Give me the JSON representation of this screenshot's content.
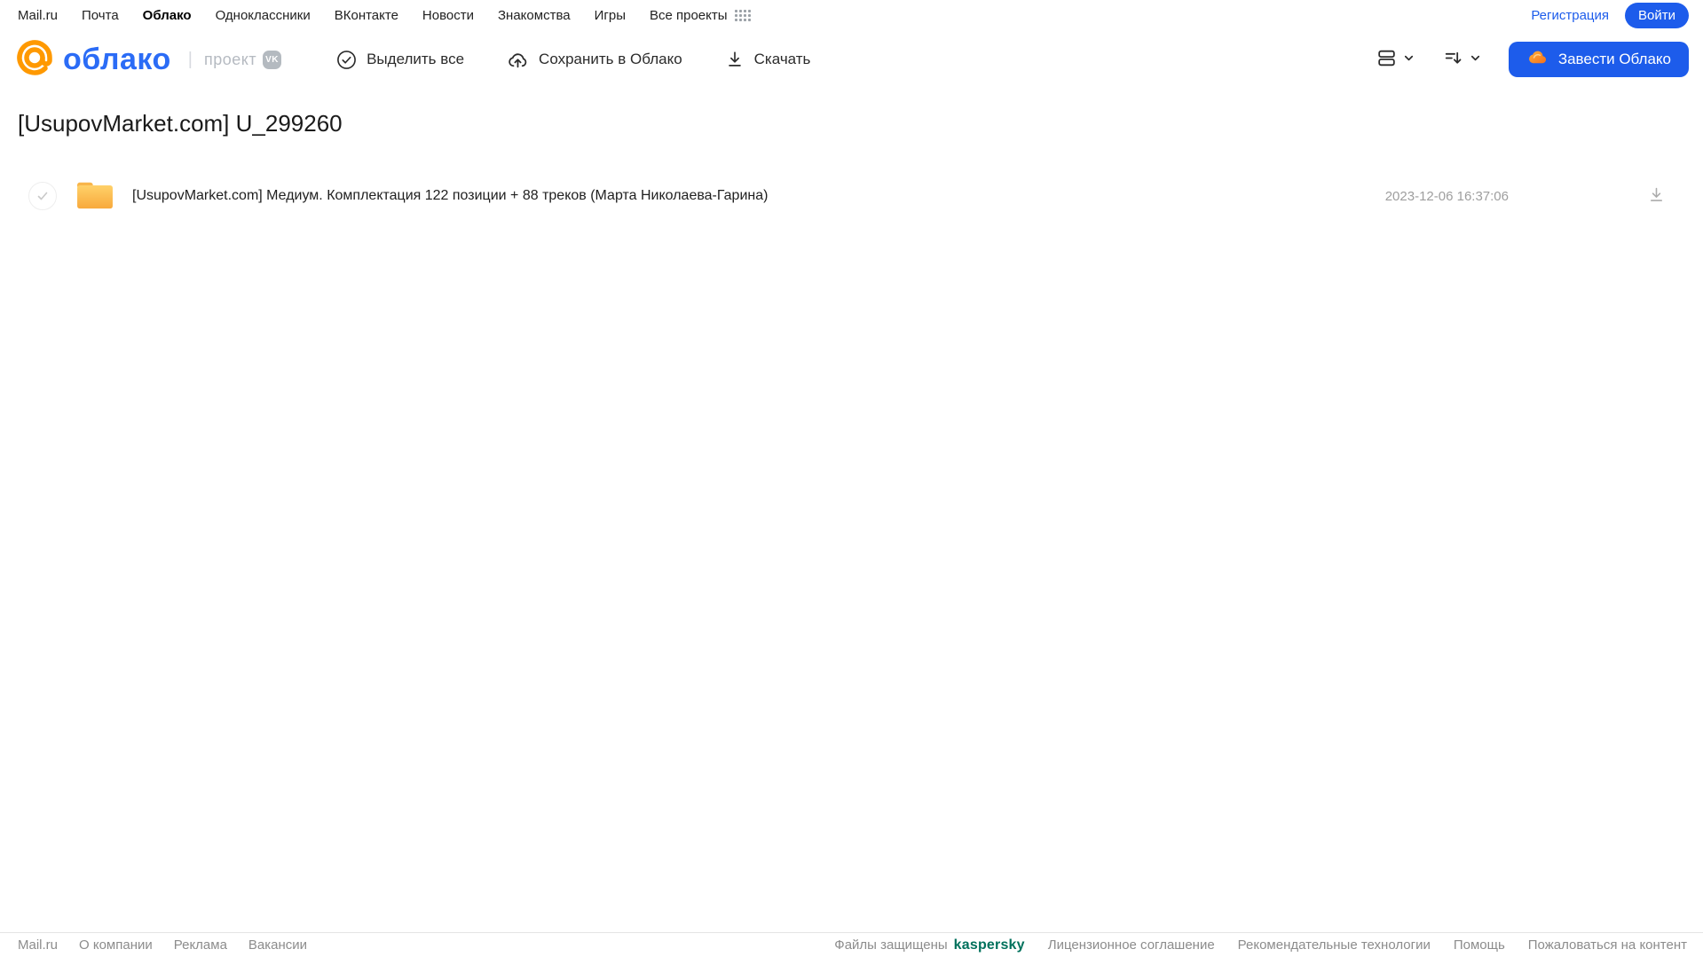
{
  "colors": {
    "accent_blue": "#1d5ceb",
    "logo_orange": "#ff9900",
    "logo_blue": "#2b6cf6",
    "folder_yellow": "#f9ae3c",
    "kaspersky_green": "#00715c"
  },
  "top_nav": {
    "links": [
      "Mail.ru",
      "Почта",
      "Облако",
      "Одноклассники",
      "ВКонтакте",
      "Новости",
      "Знакомства",
      "Игры",
      "Все проекты"
    ],
    "active_link": "Облако",
    "register_label": "Регистрация",
    "login_label": "Войти"
  },
  "header": {
    "logo": {
      "product": "облако",
      "separator": "|",
      "project": "проект",
      "vk_badge": "VK"
    },
    "toolbar": {
      "select_all": "Выделить все",
      "save_to_cloud": "Сохранить в Облако",
      "download": "Скачать"
    },
    "create_cloud_label": "Завести Облако"
  },
  "main": {
    "title": "[UsupovMarket.com] U_299260",
    "files": [
      {
        "type": "folder",
        "name": "[UsupovMarket.com] Медиум. Комплектация 122 позиции + 88 треков (Марта Николаева-Гарина)",
        "modified": "2023-12-06 16:37:06"
      }
    ]
  },
  "footer": {
    "left_links": [
      "Mail.ru",
      "О компании",
      "Реклама",
      "Вакансии"
    ],
    "protected_label": "Файлы защищены",
    "kaspersky_label": "kaspersky",
    "right_links": [
      "Лицензионное соглашение",
      "Рекомендательные технологии",
      "Помощь",
      "Пожаловаться на контент"
    ]
  }
}
